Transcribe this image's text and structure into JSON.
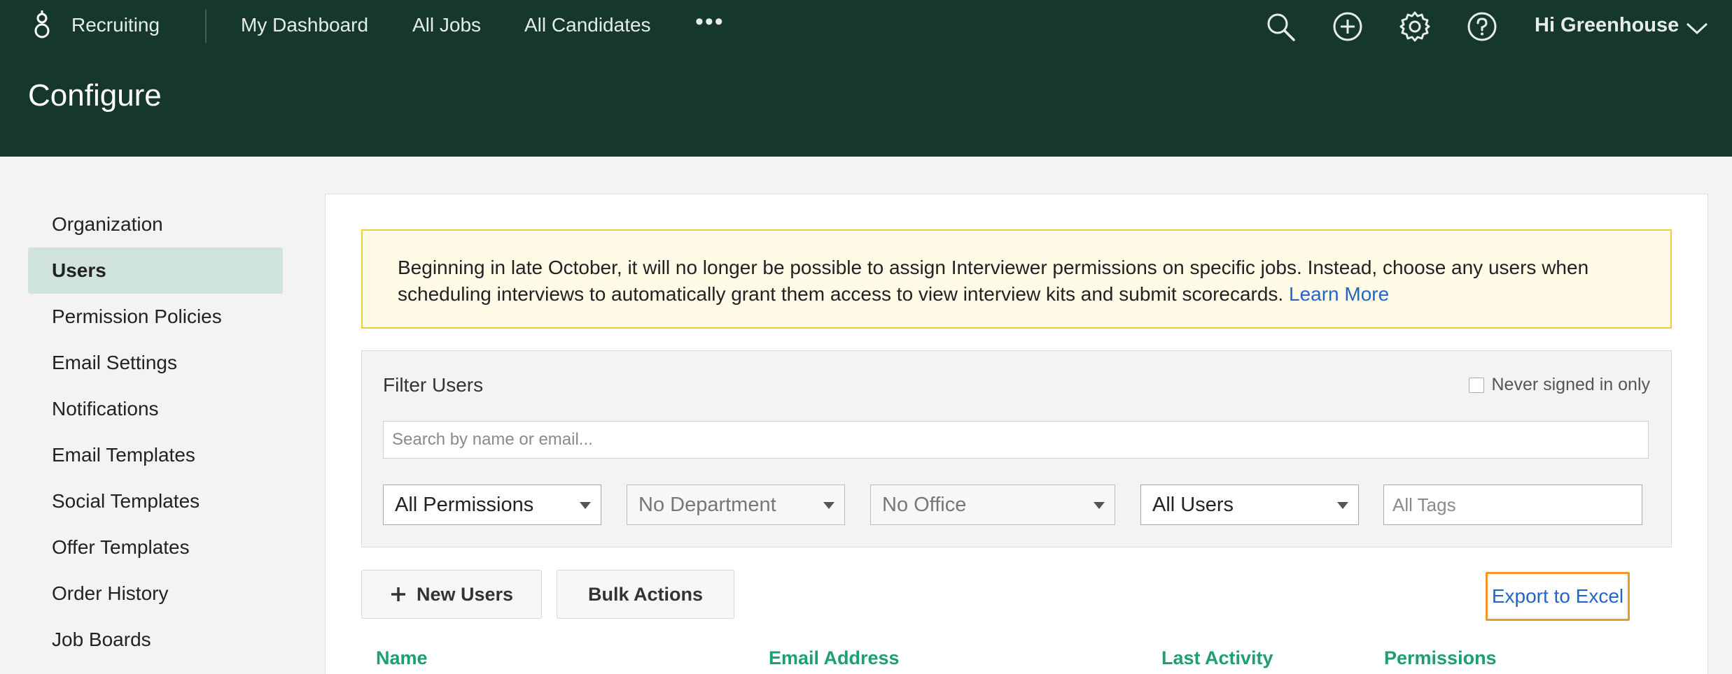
{
  "header": {
    "brand": "Recruiting",
    "nav": [
      "My Dashboard",
      "All Jobs",
      "All Candidates"
    ],
    "more": "•••",
    "greeting": "Hi Greenhouse",
    "page_title": "Configure",
    "icons": [
      "search-icon",
      "add-circle-icon",
      "gear-icon",
      "help-icon",
      "chevron-down-icon"
    ]
  },
  "sidebar": {
    "items": [
      {
        "label": "Organization"
      },
      {
        "label": "Users",
        "active": true
      },
      {
        "label": "Permission Policies"
      },
      {
        "label": "Email Settings"
      },
      {
        "label": "Notifications"
      },
      {
        "label": "Email Templates"
      },
      {
        "label": "Social Templates"
      },
      {
        "label": "Offer Templates"
      },
      {
        "label": "Order History"
      },
      {
        "label": "Job Boards"
      }
    ]
  },
  "notice": {
    "text": "Beginning in late October, it will no longer be possible to assign Interviewer permissions on specific jobs. Instead, choose any users when scheduling interviews to automatically grant them access to view interview kits and submit scorecards.",
    "link": "Learn More"
  },
  "filter": {
    "title": "Filter Users",
    "never_signed_in": "Never signed in only",
    "search_placeholder": "Search by name or email...",
    "permissions": "All Permissions",
    "department": "No Department",
    "office": "No Office",
    "users": "All Users",
    "tags_placeholder": "All Tags"
  },
  "actions": {
    "new_users": "New Users",
    "bulk_actions": "Bulk Actions",
    "export": "Export to Excel"
  },
  "table": {
    "columns": [
      "Name",
      "Email Address",
      "Last Activity",
      "Permissions"
    ]
  },
  "colors": {
    "header_bg": "#15372c",
    "accent_green": "#1e9f70",
    "link_blue": "#2565c7",
    "export_border": "#f2962b",
    "notice_bg": "#fffbe7",
    "notice_border": "#f2cc3b",
    "active_sidebar": "#d0e4dd"
  }
}
